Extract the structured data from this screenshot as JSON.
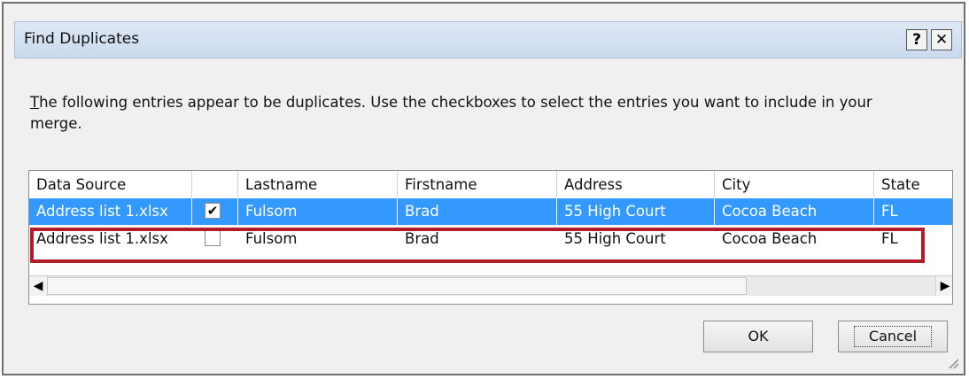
{
  "dialog": {
    "title": "Find Duplicates",
    "help_label": "?",
    "close_label": "✕",
    "intro_first_letter": "T",
    "intro_rest": "he following entries appear to be duplicates. Use the checkboxes to select the entries you want to include in your merge."
  },
  "grid": {
    "columns": [
      "Data Source",
      "",
      "Lastname",
      "Firstname",
      "Address",
      "City",
      "State"
    ],
    "rows": [
      {
        "data_source": "Address list 1.xlsx",
        "checked": "✔",
        "lastname": "Fulsom",
        "firstname": "Brad",
        "address": "55 High Court",
        "city": "Cocoa Beach",
        "state": "FL"
      },
      {
        "data_source": "Address list 1.xlsx",
        "checked": "",
        "lastname": "Fulsom",
        "firstname": "Brad",
        "address": "55 High Court",
        "city": "Cocoa Beach",
        "state": "FL"
      }
    ],
    "selected_row": 0,
    "highlighted_row": 1,
    "highlight_color": "#b01c2a",
    "selection_color": "#3399ff"
  },
  "scrollbar": {
    "left_arrow": "◀",
    "right_arrow": "▶"
  },
  "buttons": {
    "ok_label": "OK",
    "cancel_label": "Cancel"
  }
}
